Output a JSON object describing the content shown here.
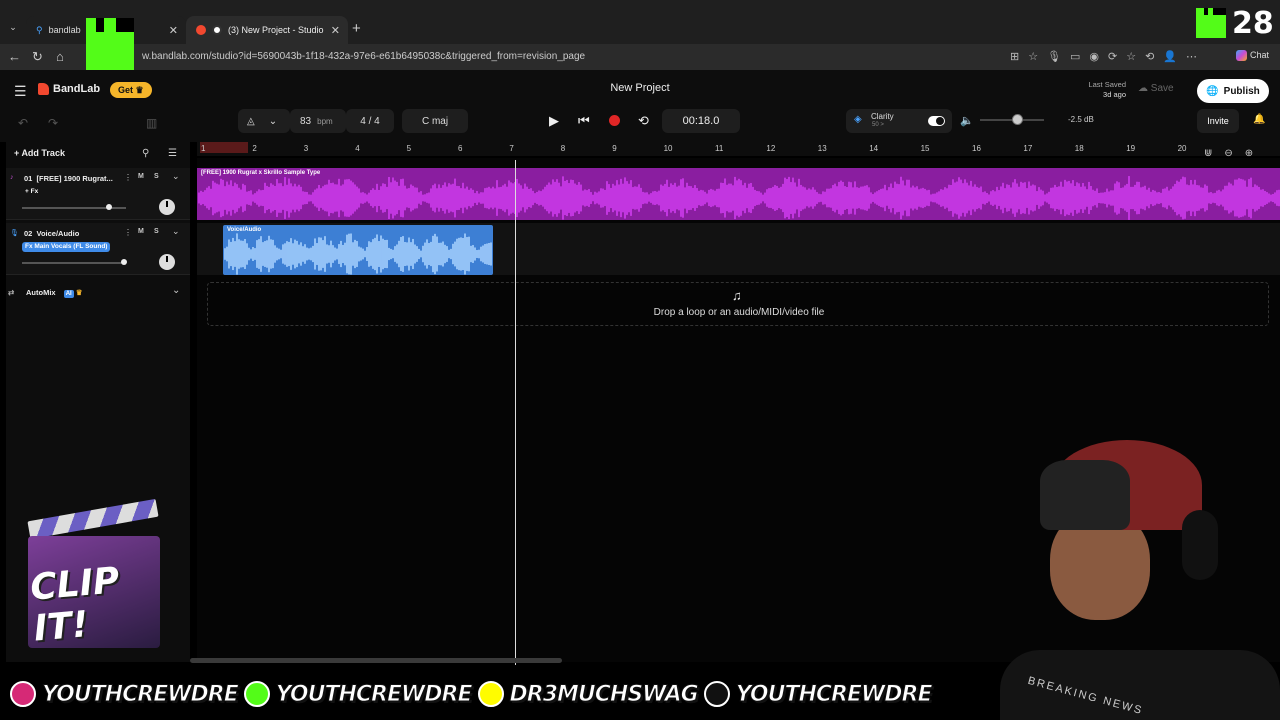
{
  "browser": {
    "tabs": [
      {
        "label": "bandlab",
        "active": false
      },
      {
        "label": "(3) New Project - Studio",
        "active": true
      }
    ],
    "url": "w.bandlab.com/studio?id=5690043b-1f18-432a-97e6-e61b6495038c&triggered_from=revision_page",
    "chat_label": "Chat"
  },
  "kick": {
    "viewer_count": "28"
  },
  "header": {
    "logo_text": "BandLab",
    "get_label": "Get",
    "project_title": "New Project",
    "last_saved_label": "Last Saved",
    "last_saved_value": "3d ago",
    "save_label": "Save",
    "publish_label": "Publish"
  },
  "toolbar": {
    "bpm": "83",
    "bpm_unit": "bpm",
    "time_signature": "4 / 4",
    "key": "C maj",
    "time_display": "00:18.0",
    "clarity_label": "Clarity",
    "clarity_sub": "50 >",
    "volume_db": "-2.5 dB",
    "invite_label": "Invite"
  },
  "tracks_panel": {
    "add_track_label": "Add Track",
    "tracks": [
      {
        "index": "01",
        "name": "[FREE] 1900 Rugrat...",
        "fx_label": "+ Fx",
        "mute": "M",
        "solo": "S",
        "volume_level": 0.84
      },
      {
        "index": "02",
        "name": "Voice/Audio",
        "fx_label": "Fx Main Vocals (FL Sound)",
        "mute": "M",
        "solo": "S",
        "volume_level": 0.98
      }
    ],
    "automix_label": "AutoMix",
    "ai_badge": "AI"
  },
  "timeline": {
    "ruler": [
      "1",
      "2",
      "3",
      "4",
      "5",
      "6",
      "7",
      "8",
      "9",
      "10",
      "11",
      "12",
      "13",
      "14",
      "15",
      "16",
      "17",
      "18",
      "19",
      "20"
    ],
    "clip1_label": "[FREE] 1900 Rugrat x Skrillo Sample Type",
    "clip2_label": "Voice/Audio",
    "drop_text": "Drop a loop or an audio/MIDI/video file"
  },
  "overlay": {
    "clip_it_text": "CLIP IT!",
    "socials": [
      {
        "icon": "instagram-icon",
        "handle": "YOUTHCREWDRE",
        "color": "#d62976"
      },
      {
        "icon": "kick-icon",
        "handle": "YOUTHCREWDRE",
        "color": "#53fc18"
      },
      {
        "icon": "snapchat-icon",
        "handle": "DR3MUCHSWAG",
        "color": "#fffc00"
      },
      {
        "icon": "tiktok-icon",
        "handle": "YOUTHCREWDRE",
        "color": "#111111"
      }
    ],
    "shirt_text": "BREAKING NEWS"
  }
}
